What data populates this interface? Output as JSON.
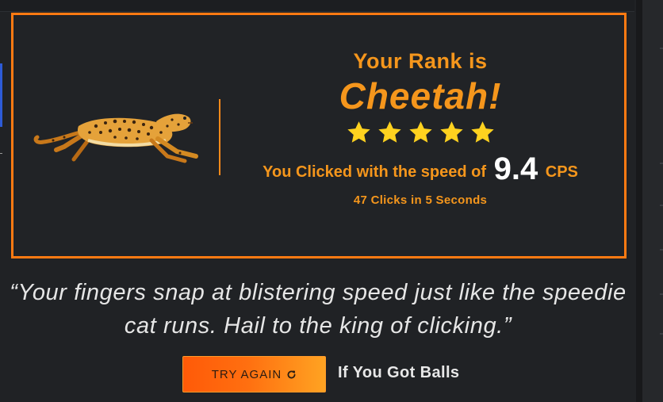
{
  "result": {
    "title": "Your Rank is",
    "rank": "Cheetah!",
    "star_count": 5,
    "speed_prefix": "You Clicked with the speed of",
    "cps_value": "9.4",
    "cps_unit": "CPS",
    "clicks_summary": "47 Clicks in 5 Seconds"
  },
  "quote": {
    "line1": "“Your fingers snap at blistering speed just like the speedie",
    "line2": "cat runs. Hail to the king of clicking.”"
  },
  "actions": {
    "try_again_label": "TRY AGAIN",
    "balls_link": "If You Got Balls"
  },
  "icons": {
    "hero": "cheetah-illustration",
    "rating": "star-icon",
    "retry": "refresh-icon"
  },
  "colors": {
    "accent": "#ff7a12",
    "text_orange": "#f5961c",
    "star": "#ffd21f",
    "background": "#202225"
  }
}
